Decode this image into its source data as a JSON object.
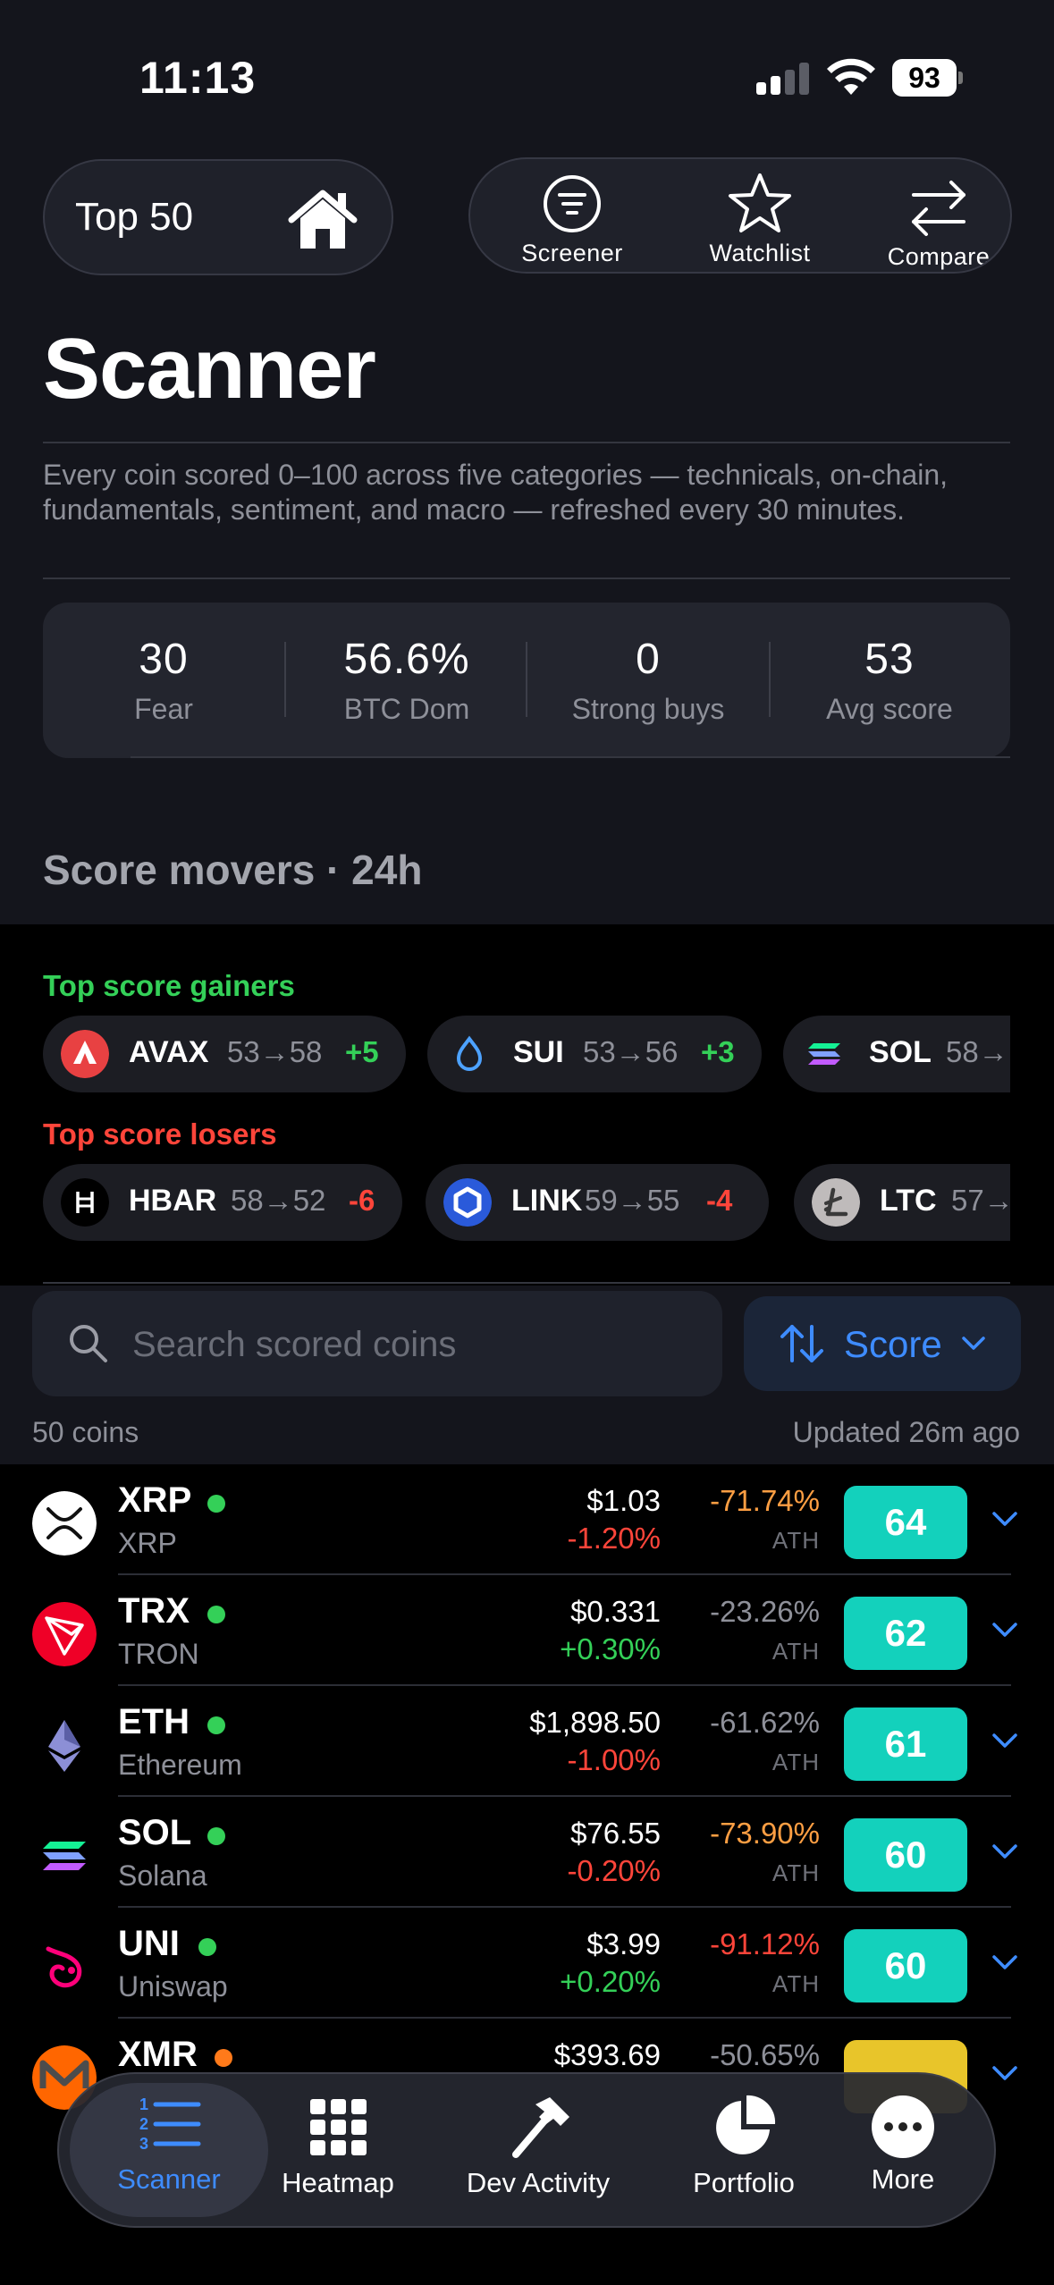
{
  "status_bar": {
    "time": "11:13",
    "battery": "93"
  },
  "header": {
    "scope_label": "Top 50",
    "toolbar": [
      {
        "label": "Screener",
        "icon": "filter-icon"
      },
      {
        "label": "Watchlist",
        "icon": "star-icon"
      },
      {
        "label": "Compare",
        "icon": "compare-arrows-icon"
      }
    ]
  },
  "page": {
    "title": "Scanner",
    "description": "Every coin scored 0–100 across five categories — technicals, on-chain, fundamentals, sentiment, and macro — refreshed every 30 minutes."
  },
  "stats": [
    {
      "value": "30",
      "label": "Fear"
    },
    {
      "value": "56.6%",
      "label": "BTC Dom"
    },
    {
      "value": "0",
      "label": "Strong buys"
    },
    {
      "value": "53",
      "label": "Avg score"
    }
  ],
  "movers": {
    "title": "Score movers · 24h",
    "gainers_label": "Top score gainers",
    "losers_label": "Top score losers",
    "gainers": [
      {
        "symbol": "AVAX",
        "range": "53→58",
        "delta": "+5",
        "color": "#e84142"
      },
      {
        "symbol": "SUI",
        "range": "53→56",
        "delta": "+3",
        "color": "#4da2ff"
      },
      {
        "symbol": "SOL",
        "range": "58→",
        "delta": "",
        "color": "#9945ff"
      }
    ],
    "losers": [
      {
        "symbol": "HBAR",
        "range": "58→52",
        "delta": "-6",
        "color": "#000000"
      },
      {
        "symbol": "LINK",
        "range": "59→55",
        "delta": "-4",
        "color": "#2a5ada"
      },
      {
        "symbol": "LTC",
        "range": "57→",
        "delta": "",
        "color": "#bfbbbb"
      }
    ]
  },
  "search": {
    "placeholder": "Search scored coins",
    "sort_label": "Score"
  },
  "list_meta": {
    "count": "50 coins",
    "updated": "Updated 26m ago"
  },
  "coins": [
    {
      "symbol": "XRP",
      "name": "XRP",
      "price": "$1.03",
      "change": "-1.20%",
      "dir": "down",
      "ath": "-71.74%",
      "ath_color": "orange",
      "ath_label": "ATH",
      "score": "64",
      "dot": "#34d058",
      "icon_color": "#ffffff"
    },
    {
      "symbol": "TRX",
      "name": "TRON",
      "price": "$0.331",
      "change": "+0.30%",
      "dir": "up",
      "ath": "-23.26%",
      "ath_color": "grey",
      "ath_label": "ATH",
      "score": "62",
      "dot": "#34d058",
      "icon_color": "#ef0027"
    },
    {
      "symbol": "ETH",
      "name": "Ethereum",
      "price": "$1,898.50",
      "change": "-1.00%",
      "dir": "down",
      "ath": "-61.62%",
      "ath_color": "grey",
      "ath_label": "ATH",
      "score": "61",
      "dot": "#34d058",
      "icon_color": "#627eea"
    },
    {
      "symbol": "SOL",
      "name": "Solana",
      "price": "$76.55",
      "change": "-0.20%",
      "dir": "down",
      "ath": "-73.90%",
      "ath_color": "orange",
      "ath_label": "ATH",
      "score": "60",
      "dot": "#34d058",
      "icon_color": "#9945ff"
    },
    {
      "symbol": "UNI",
      "name": "Uniswap",
      "price": "$3.99",
      "change": "+0.20%",
      "dir": "up",
      "ath": "-91.12%",
      "ath_color": "red",
      "ath_label": "ATH",
      "score": "60",
      "dot": "#34d058",
      "icon_color": "#ff007a"
    },
    {
      "symbol": "XMR",
      "name": "",
      "price": "$393.69",
      "change": "",
      "dir": "up",
      "ath": "-50.65%",
      "ath_color": "grey",
      "ath_label": "",
      "score": "",
      "dot": "#ff7a1a",
      "icon_color": "#ff6600"
    }
  ],
  "tabbar": [
    {
      "label": "Scanner",
      "icon": "numbered-list-icon",
      "active": true
    },
    {
      "label": "Heatmap",
      "icon": "grid-icon",
      "active": false
    },
    {
      "label": "Dev Activity",
      "icon": "hammer-icon",
      "active": false
    },
    {
      "label": "Portfolio",
      "icon": "pie-chart-icon",
      "active": false
    },
    {
      "label": "More",
      "icon": "more-dots-icon",
      "active": false
    }
  ],
  "colors": {
    "accent": "#3e8cff",
    "score": "#13d1bc",
    "up": "#34d058",
    "down": "#ff453a"
  }
}
